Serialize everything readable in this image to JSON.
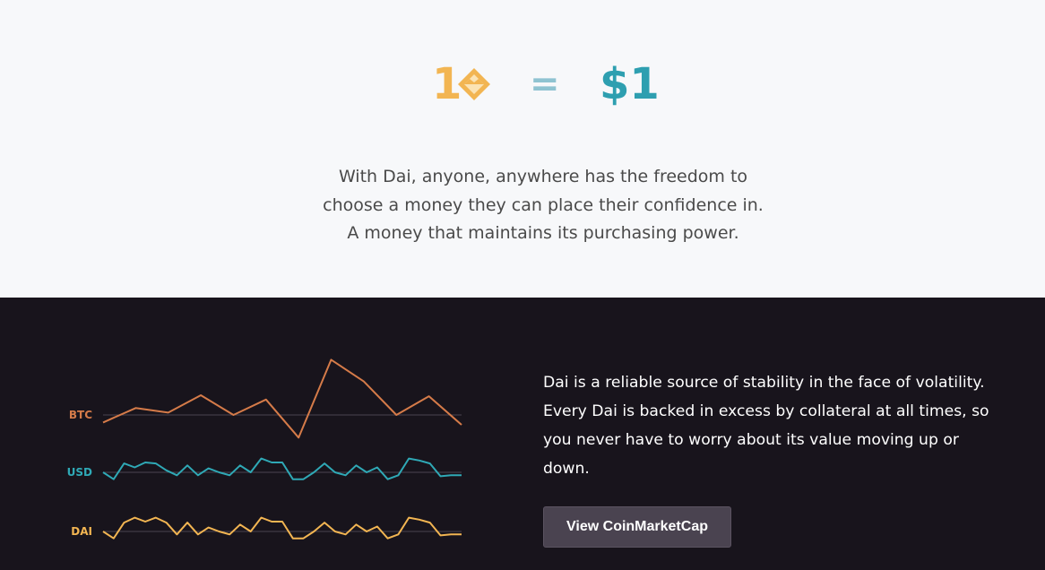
{
  "equation": {
    "dai_amount": "1",
    "equals": "=",
    "usd_amount": "$1",
    "colors": {
      "dai": "#f2b552",
      "equals": "#8fc3d1",
      "usd": "#2e9fb0"
    }
  },
  "tagline": {
    "lines": [
      "With Dai, anyone, anywhere has the freedom to",
      "choose a money they can place their confidence in.",
      "A money that maintains its purchasing power."
    ]
  },
  "stability": {
    "lines": [
      "Dai is a reliable source of stability in the face of volatility.",
      "Every Dai is backed in excess by collateral at all times, so",
      "you never have to worry about its value moving up or",
      "down."
    ],
    "button_label": "View CoinMarketCap"
  },
  "chart_data": {
    "type": "line",
    "title": "",
    "xlabel": "",
    "ylabel": "",
    "grid": false,
    "series": [
      {
        "name": "BTC",
        "color": "#d57b49",
        "values": [
          -0.38,
          0.35,
          0.12,
          1.0,
          0.0,
          0.78,
          -1.15,
          2.8,
          1.7,
          0.0,
          0.95,
          -0.5
        ]
      },
      {
        "name": "USD",
        "color": "#2fa9b6",
        "values": [
          0.0,
          -0.35,
          0.45,
          0.25,
          0.5,
          0.45,
          0.1,
          -0.15,
          0.35,
          -0.15,
          0.2,
          0.0,
          -0.15,
          0.35,
          0.0,
          0.7,
          0.5,
          0.5,
          -0.35,
          -0.35,
          0.0,
          0.45,
          0.0,
          -0.15,
          0.35,
          0.0,
          0.25,
          -0.35,
          -0.15,
          0.7,
          0.6,
          0.45,
          -0.2,
          -0.15,
          -0.15
        ]
      },
      {
        "name": "DAI",
        "color": "#f2b552",
        "values": [
          0.0,
          -0.35,
          0.45,
          0.7,
          0.5,
          0.7,
          0.45,
          -0.15,
          0.45,
          -0.15,
          0.2,
          0.0,
          -0.15,
          0.35,
          0.0,
          0.7,
          0.5,
          0.5,
          -0.35,
          -0.35,
          0.0,
          0.45,
          0.0,
          -0.15,
          0.35,
          0.0,
          0.25,
          -0.35,
          -0.15,
          0.7,
          0.6,
          0.45,
          -0.2,
          -0.15,
          -0.15
        ]
      }
    ]
  }
}
